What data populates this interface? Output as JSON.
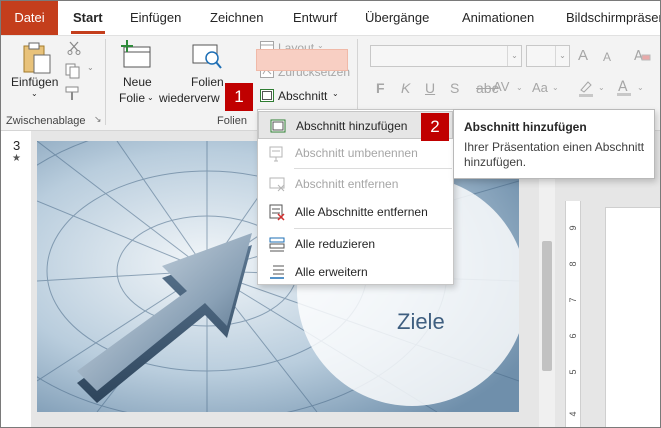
{
  "tabs": {
    "file": "Datei",
    "start": "Start",
    "insert": "Einfügen",
    "draw": "Zeichnen",
    "design": "Entwurf",
    "transitions": "Übergänge",
    "animations": "Animationen",
    "slideshow": "Bildschirmpräsen"
  },
  "ribbon": {
    "paste_label": "Einfügen",
    "clipboard_group": "Zwischenablage",
    "new_slide_line1": "Neue",
    "new_slide_line2": "Folie",
    "reuse_line1": "Folien",
    "reuse_line2": "wiederverw",
    "slides_group": "Folien",
    "layout_label": "Layout",
    "reset_label": "Zurücksetzen",
    "section_label": "Abschnitt",
    "format_bold": "F",
    "format_italic": "K",
    "format_underline": "U",
    "format_strike": "S",
    "char_spacing": "AV",
    "case": "Aa",
    "grow_font": "A",
    "shrink_font": "A"
  },
  "section_menu": {
    "items": [
      {
        "label": "Abschnitt hinzufügen",
        "enabled": true
      },
      {
        "label": "Abschnitt umbenennen",
        "enabled": false
      },
      {
        "label": "Abschnitt entfernen",
        "enabled": false
      },
      {
        "label": "Alle Abschnitte entfernen",
        "enabled": true
      },
      {
        "label": "Alle reduzieren",
        "enabled": true
      },
      {
        "label": "Alle erweitern",
        "enabled": true
      }
    ]
  },
  "tooltip": {
    "title": "Abschnitt hinzufügen",
    "body": "Ihrer Präsentation einen Abschnitt hinzufügen."
  },
  "callouts": {
    "one": "1",
    "two": "2"
  },
  "slide": {
    "number": "3",
    "star": "★",
    "title": "Ziele"
  },
  "ruler": {
    "marks": [
      "9",
      "8",
      "7",
      "6",
      "5",
      "4"
    ]
  },
  "colors": {
    "accent": "#c43e1c",
    "callout": "#c00000",
    "section_button_highlight": "#f8cfc3"
  }
}
